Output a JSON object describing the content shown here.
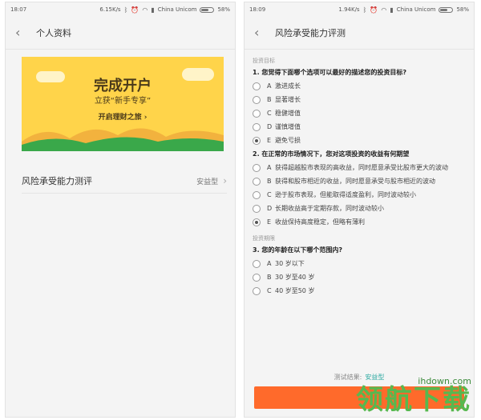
{
  "left_phone": {
    "status": {
      "time": "18:07",
      "speed": "6.15K/s",
      "carrier": "China Unicom",
      "battery": "58%"
    },
    "navbar": {
      "title": "个人资料"
    },
    "banner": {
      "title": "完成开户",
      "subtitle": "立获“新手专享”",
      "cta": "开启理财之旅 ›"
    },
    "risk_row": {
      "label": "风险承受能力测评",
      "value": "安益型"
    }
  },
  "right_phone": {
    "status": {
      "time": "18:09",
      "speed": "1.94K/s",
      "carrier": "China Unicom",
      "battery": "58%"
    },
    "navbar": {
      "title": "风险承受能力评测"
    },
    "sections": [
      {
        "label": "投资目标",
        "questions": [
          {
            "title": "1. 您觉得下面哪个选项可以最好的描述您的投资目标?",
            "options": [
              {
                "letter": "A",
                "text": "激进成长",
                "checked": false
              },
              {
                "letter": "B",
                "text": "显著增长",
                "checked": false
              },
              {
                "letter": "C",
                "text": "稳健增值",
                "checked": false
              },
              {
                "letter": "D",
                "text": "谨慎增值",
                "checked": false
              },
              {
                "letter": "E",
                "text": "避免亏损",
                "checked": true
              }
            ]
          },
          {
            "title": "2. 在正常的市场情况下，您对这项投资的收益有何期望",
            "options": [
              {
                "letter": "A",
                "text": "获得超越股市表现的高收益，同时愿意承受比股市更大的波动",
                "checked": false
              },
              {
                "letter": "B",
                "text": "获得和股市相近的收益，同时愿意承受与股市相近的波动",
                "checked": false
              },
              {
                "letter": "C",
                "text": "逊于股市表现，但能取得适度盈利，同时波动较小",
                "checked": false
              },
              {
                "letter": "D",
                "text": "长期收益高于定期存款，同时波动较小",
                "checked": false
              },
              {
                "letter": "E",
                "text": "收益保持高度稳定，但略有薄利",
                "checked": true
              }
            ]
          }
        ]
      },
      {
        "label": "投资期限",
        "questions": [
          {
            "title": "3. 您的年龄在以下哪个范围内?",
            "options": [
              {
                "letter": "A",
                "text": "30 岁以下",
                "checked": false
              },
              {
                "letter": "B",
                "text": "30 岁至40 岁",
                "checked": false
              },
              {
                "letter": "C",
                "text": "40 岁至50 岁",
                "checked": false
              }
            ]
          }
        ]
      }
    ],
    "result": {
      "label": "测试结果:",
      "value": "安益型"
    }
  },
  "watermark": {
    "url": "ihdown.com",
    "text": "领航下载"
  },
  "colors": {
    "banner_bg": "#ffd44a",
    "hills_green": "#3aa84a",
    "accent_teal": "#2aa8a0",
    "submit_orange": "#ff6a2b",
    "watermark_green": "#57b84f"
  }
}
